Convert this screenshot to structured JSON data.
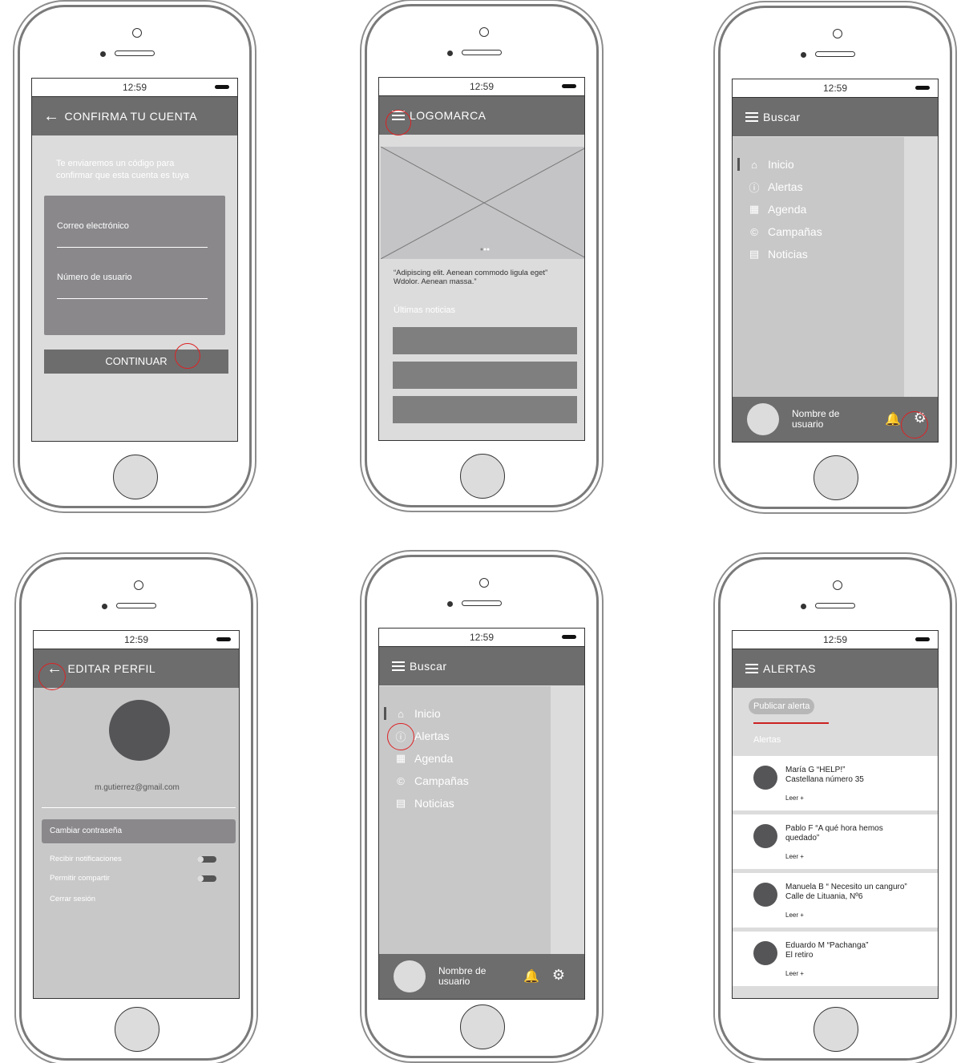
{
  "status_time": "12:59",
  "phone1": {
    "title": "CONFIRMA TU CUENTA",
    "intro_line1": "Te enviaremos un código para",
    "intro_line2": "confirmar que esta cuenta es tuya",
    "email_label": "Correo electrónico",
    "user_label": "Número de usuario",
    "continue_label": "CONTINUAR"
  },
  "phone2": {
    "title": "LOGOMARCA",
    "quote": "“Adipiscing elit. Aenean commodo ligula eget” Wdolor. Aenean massa.”",
    "section": "Últimas noticias"
  },
  "menu": {
    "search": "Buscar",
    "items": [
      "Inicio",
      "Alertas",
      "Agenda",
      "Campañas",
      "Noticias"
    ],
    "icons": [
      "home-icon",
      "alert-icon",
      "calendar-icon",
      "copyright-icon",
      "document-icon"
    ],
    "user_line1": "Nombre de",
    "user_line2": "usuario"
  },
  "phone4": {
    "title": "EDITAR PERFIL",
    "email": "m.gutierrez@gmail.com",
    "change_password": "Cambiar contraseña",
    "notifications": "Recibir notificaciones",
    "share": "Permitir compartir",
    "logout": "Cerrar sesión"
  },
  "phone6": {
    "title": "ALERTAS",
    "publish": "Publicar alerta",
    "section": "Alertas",
    "alerts": [
      {
        "line1": "María G  “HELP!”",
        "line2": "Castellana número 35",
        "more": "Leer +"
      },
      {
        "line1": "Pablo F  “A qué hora hemos",
        "line2": "quedado”",
        "more": "Leer +"
      },
      {
        "line1": "Manuela B “ Necesito un canguro”",
        "line2": "Calle de Lituania, Nº6",
        "more": "Leer +"
      },
      {
        "line1": "Eduardo M “Pachanga”",
        "line2": "El retiro",
        "more": "Leer +"
      }
    ]
  }
}
